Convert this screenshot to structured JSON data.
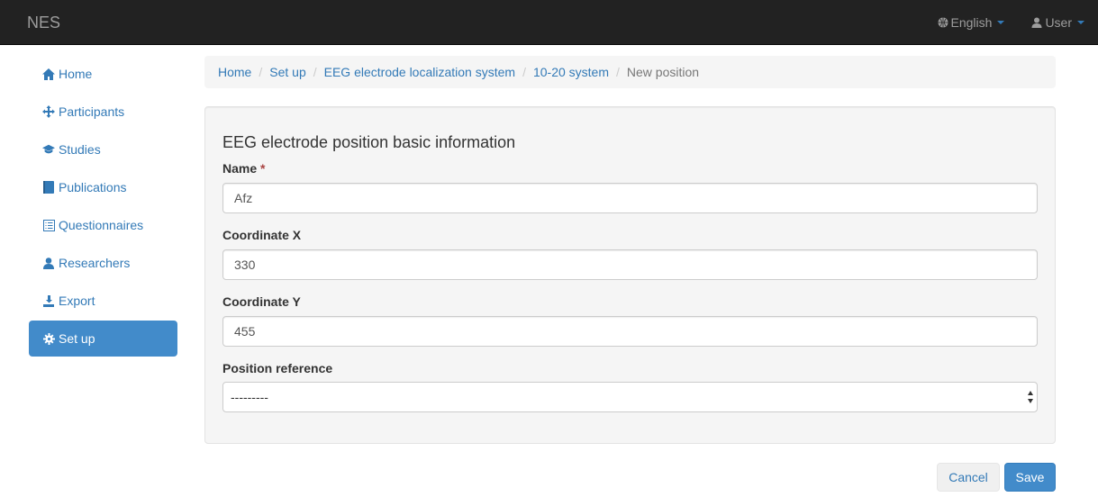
{
  "navbar": {
    "brand": "NES",
    "language": {
      "label": "English",
      "icon": "globe-icon"
    },
    "user": {
      "label": "User",
      "icon": "user-icon"
    }
  },
  "sidebar": {
    "items": [
      {
        "label": "Home",
        "icon": "home-icon"
      },
      {
        "label": "Participants",
        "icon": "move-icon"
      },
      {
        "label": "Studies",
        "icon": "education-icon"
      },
      {
        "label": "Publications",
        "icon": "book-icon"
      },
      {
        "label": "Questionnaires",
        "icon": "list-alt-icon"
      },
      {
        "label": "Researchers",
        "icon": "user-icon"
      },
      {
        "label": "Export",
        "icon": "export-icon"
      },
      {
        "label": "Set up",
        "icon": "cog-icon",
        "active": true
      }
    ]
  },
  "breadcrumb": {
    "items": [
      "Home",
      "Set up",
      "EEG electrode localization system",
      "10-20 system"
    ],
    "current": "New position",
    "separator": "/"
  },
  "form": {
    "title": "EEG electrode position basic information",
    "name_label": "Name",
    "required_mark": "*",
    "name_value": "Afz",
    "coord_x_label": "Coordinate X",
    "coord_x_value": "330",
    "coord_y_label": "Coordinate Y",
    "coord_y_value": "455",
    "position_ref_label": "Position reference",
    "position_ref_value": "---------"
  },
  "actions": {
    "cancel": "Cancel",
    "save": "Save"
  },
  "colors": {
    "navbar_bg": "#222222",
    "link": "#337ab7",
    "active_bg": "#428bca"
  }
}
